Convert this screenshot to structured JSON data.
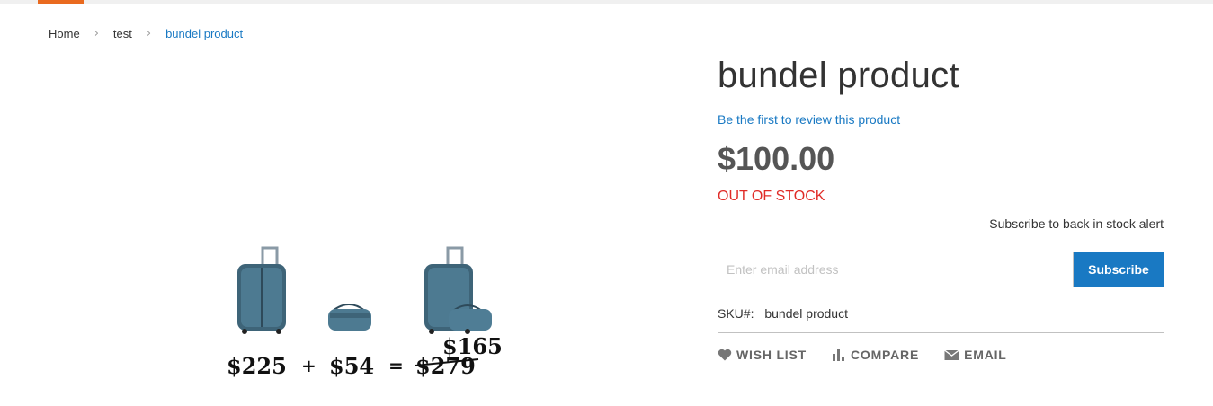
{
  "breadcrumb": {
    "items": [
      {
        "label": "Home"
      },
      {
        "label": "test"
      }
    ],
    "current": "bundel product"
  },
  "product": {
    "title": "bundel product",
    "review_link": "Be the first to review this product",
    "price": "$100.00",
    "stock_status": "OUT OF STOCK",
    "stock_alert_label": "Subscribe to back in stock alert",
    "email_placeholder": "Enter email address",
    "subscribe_button": "Subscribe",
    "sku_label": "SKU#:",
    "sku_value": "bundel product"
  },
  "image": {
    "price_a": "$225",
    "plus": "+",
    "price_b": "$54",
    "equals": "=",
    "price_total_old": "$279",
    "price_total_new": "$165"
  },
  "actions": {
    "wishlist": "WISH LIST",
    "compare": "COMPARE",
    "email": "EMAIL"
  },
  "icons": {
    "wishlist": "heart-icon",
    "compare": "bar-chart-icon",
    "email": "envelope-icon",
    "separator": "chevron-right-icon"
  },
  "colors": {
    "accent": "#e96a1f",
    "link": "#1979c3",
    "out_of_stock": "#e02b27",
    "button": "#1979c3"
  }
}
